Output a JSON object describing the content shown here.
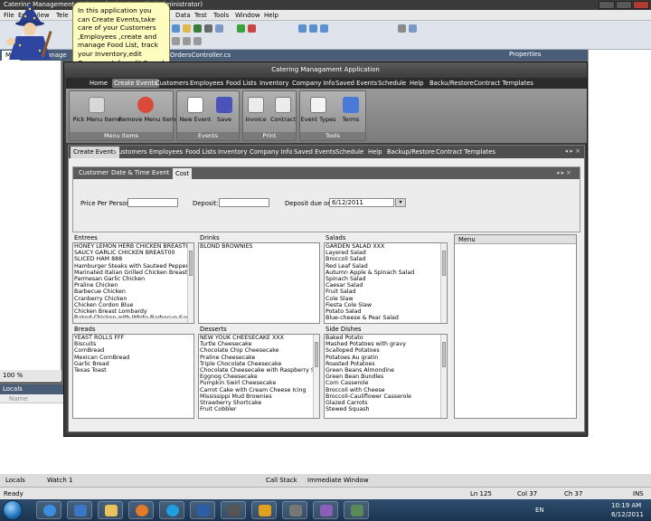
{
  "ide": {
    "title": "Catering Management - Microsoft Visual Studio (Administrator)",
    "menu": [
      "File",
      "Edit",
      "View",
      "Tele",
      "Data",
      "Test",
      "Tools",
      "Window",
      "Help"
    ],
    "doc_tabs": [
      "Mai",
      "CateringManage",
      "OrdersController.cs"
    ],
    "properties_label": "Properties",
    "zoom": "100 %",
    "locals_label": "Locals",
    "locals_col_name": "Name",
    "bottom_tab_locals": "Locals",
    "bottom_tab_watch": "Watch 1",
    "bottom_tab_callstack": "Call Stack",
    "bottom_tab_immediate": "Immediate Window",
    "status": {
      "ready": "Ready",
      "ln": "Ln 125",
      "col": "Col 37",
      "ch": "Ch 37",
      "ins": "INS"
    }
  },
  "taskbar": {
    "lang": "EN",
    "time": "10:19 AM",
    "date": "6/12/2011"
  },
  "tooltip": {
    "text": "In this application you can Create Events,take care of your Customers ,Employees ,create and manage Food List, track your Inventory,edit Company Info, edit Saved"
  },
  "app": {
    "title": "Catering Managament Application",
    "menu": [
      "Home",
      "Create Events",
      "Customers",
      "Employees",
      "Food Lists",
      "Inventory",
      "Company Info",
      "Saved Events",
      "Schedule",
      "Help",
      "Backu/Restore",
      "Contract Templates"
    ],
    "ribbon": {
      "groups": [
        {
          "label": "Menu Items",
          "buttons": [
            "Pick Menu Items",
            "Remove Menu Items"
          ]
        },
        {
          "label": "Events",
          "buttons": [
            "New Event",
            "Save"
          ]
        },
        {
          "label": "Print",
          "buttons": [
            "Invoice",
            "Contract"
          ]
        },
        {
          "label": "Tools",
          "buttons": [
            "Event Types",
            "Terms"
          ]
        }
      ]
    },
    "inner_tabs": [
      "Create Events",
      "Customers",
      "Employees",
      "Food Lists",
      "Inventory",
      "Company Info",
      "Saved Events",
      "Schedule",
      "Help",
      "Backup/Restore",
      "Contract Templates"
    ],
    "inner_controls": "◂ ▸ ×",
    "sub_tabs": [
      "Customer",
      "Date & Time",
      "Event",
      "Cost"
    ],
    "sub_controls": "◂ ▸ ×",
    "cost": {
      "price_label": "Price Per Person :",
      "price_value": "",
      "deposit_label": "Deposit:",
      "deposit_value": "",
      "due_label": "Deposit due on:",
      "due_value": "6/12/2011"
    },
    "lists": {
      "entrees": {
        "label": "Entrees",
        "items": [
          "HONEY LEMON HERB CHICKEN BREASTGG",
          "SAUCY GARLIC CHICKEN BREAST00",
          "SLICED HAM 888",
          "Hamburger Steaks with Sauteed Peppers & On",
          "Marinated Italian Grilled Chicken Breast",
          "Parmesan Garlic Chicken",
          "Praline Chicken",
          "Barbecue Chicken",
          "Cranberry Chicken",
          "Chicken Cordon Blue",
          "Chicken Breast Lombardy",
          "Baked Chicken with White Barbecue Sauce"
        ]
      },
      "drinks": {
        "label": "Drinks",
        "items": [
          "BLOND BROWNIES"
        ]
      },
      "salads": {
        "label": "Salads",
        "items": [
          "GARDEN SALAD XXX",
          "Layered Salad",
          "Broccoli Salad",
          "Red Leaf Salad",
          "Autumn Apple & Spinach Salad",
          "Spinach Salad",
          "Caesar Salad",
          "Fruit Salad",
          "Cole Slaw",
          "Fiesta Cole Slaw",
          "Potato Salad",
          "Blue-cheese & Pear Salad"
        ]
      },
      "breads": {
        "label": "Breads",
        "items": [
          "YEAST ROLLS FFF",
          "Biscuits",
          "CornBread",
          "Mexican CornBread",
          "Garlic Bread",
          "Texas Toast"
        ]
      },
      "desserts": {
        "label": "Desserts",
        "items": [
          "NEW YOUK CHEESECAKE XXX",
          "Turtle Cheesecake",
          "Chocolate Chip Cheesecake",
          "Praline Cheesecake",
          "Triple Chocolate Cheesecake",
          "Chocolate Cheesecake with Raspberry Sauce",
          "Eggnog Cheesecake",
          "Pumpkin Swirl Cheesecake",
          "Carrot Cake with Cream Cheese Icing",
          "Mississippi Mud Brownies",
          "Strawberry Shortcake",
          "Fruit Cobbler"
        ]
      },
      "sides": {
        "label": "Side Dishes",
        "items": [
          "Baked Potato",
          "Mashed Potatoes with gravy",
          "Scalloped Potatoes",
          "Potatoes Au gratin",
          "Roasted Potatoes",
          "Green Beans Almondine",
          "Green Bean Bundles",
          "Corn Casserole",
          "Broccoli with Cheese",
          "Broccoli-Cauliflower Casserole",
          "Glazed Carrots",
          "Stewed Squash"
        ]
      }
    },
    "menu_panel_label": "Menu"
  },
  "colors": {
    "accent": "#4a5d78",
    "app_bg": "#3d3d3d",
    "tooltip_bg": "#fffcc0"
  }
}
